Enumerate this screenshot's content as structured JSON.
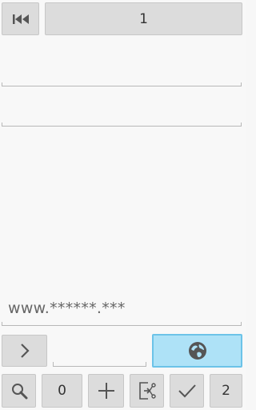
{
  "top_bar": {
    "first_icon": "skip-to-first-icon",
    "page_number": "1"
  },
  "address": {
    "url_text": "www.******.***"
  },
  "nav_row": {
    "next_icon": "chevron-right-icon",
    "go_icon": "globe-icon",
    "accent_color": "#aee2f7"
  },
  "toolbar": {
    "search_icon": "search-icon",
    "count_left": "0",
    "add_icon": "plus-icon",
    "export_icon": "share-export-icon",
    "check_icon": "check-icon",
    "count_right": "2"
  }
}
